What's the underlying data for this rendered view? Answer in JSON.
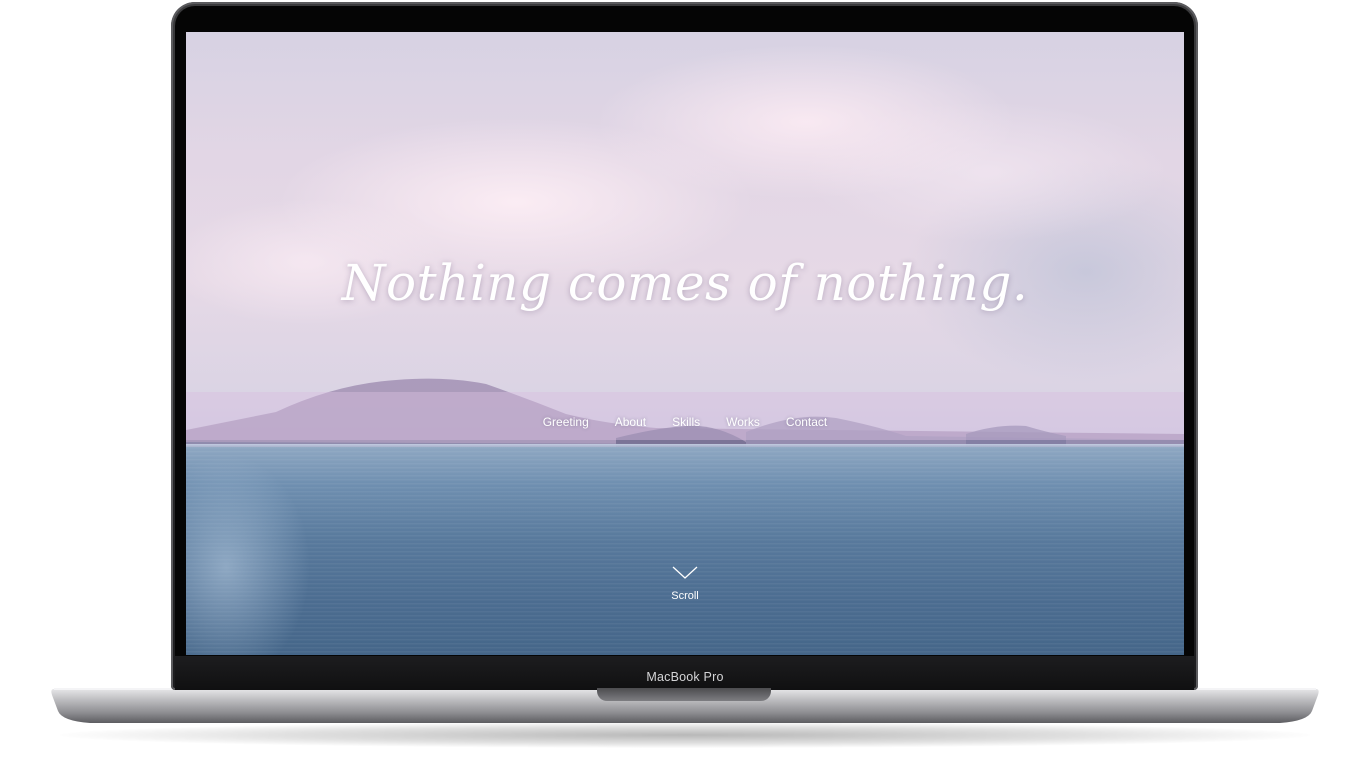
{
  "device": {
    "brand_label": "MacBook Pro"
  },
  "hero": {
    "headline": "Nothing comes of nothing."
  },
  "nav": {
    "items": [
      {
        "label": "Greeting"
      },
      {
        "label": "About"
      },
      {
        "label": "Skills"
      },
      {
        "label": "Works"
      },
      {
        "label": "Contact"
      }
    ]
  },
  "scroll": {
    "label": "Scroll",
    "icon": "chevron-down-icon"
  },
  "colors": {
    "text": "#ffffff",
    "nav_band": "#d7bee1",
    "sea": "#4b6c90",
    "sky": "#e2d6e5"
  }
}
